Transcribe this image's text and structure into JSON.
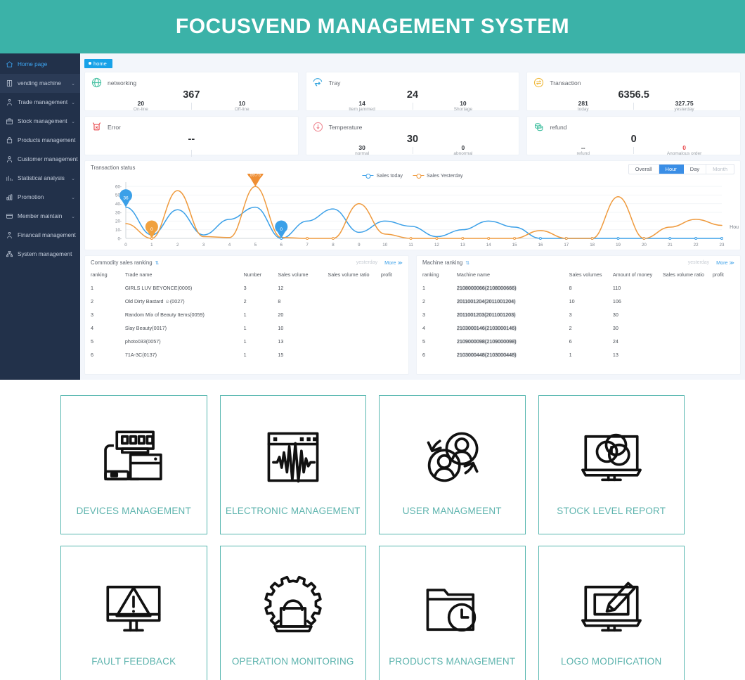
{
  "banner": {
    "title": "FOCUSVEND MANAGEMENT SYSTEM",
    "bg": "#3bb2a8"
  },
  "sidebar": {
    "items": [
      {
        "label": "Home page",
        "icon": "home-icon",
        "caret": "",
        "active": true,
        "highlight": false
      },
      {
        "label": "vending machine",
        "icon": "machine-icon",
        "caret": "⌄",
        "active": false,
        "highlight": true
      },
      {
        "label": "Trade management",
        "icon": "trade-icon",
        "caret": "⌄",
        "active": false,
        "highlight": false
      },
      {
        "label": "Stock management",
        "icon": "stock-icon",
        "caret": "⌄",
        "active": false,
        "highlight": false
      },
      {
        "label": "Products management",
        "icon": "products-icon",
        "caret": "",
        "active": false,
        "highlight": false
      },
      {
        "label": "Customer management",
        "icon": "customer-icon",
        "caret": "",
        "active": false,
        "highlight": false
      },
      {
        "label": "Statistical analysis",
        "icon": "statistics-icon",
        "caret": "⌄",
        "active": false,
        "highlight": false
      },
      {
        "label": "Promotion",
        "icon": "promotion-icon",
        "caret": "⌄",
        "active": false,
        "highlight": false
      },
      {
        "label": "Member maintain",
        "icon": "member-icon",
        "caret": "⌄",
        "active": false,
        "highlight": false
      },
      {
        "label": "Financail management",
        "icon": "finance-icon",
        "caret": "",
        "active": false,
        "highlight": false
      },
      {
        "label": "System management",
        "icon": "system-icon",
        "caret": "",
        "active": false,
        "highlight": false
      }
    ]
  },
  "tabbar": {
    "tab_label": "home"
  },
  "stats": [
    {
      "title": "networking",
      "icon": "globe-icon",
      "icon_color": "#4cc3a5",
      "main": "367",
      "left": {
        "value": "20",
        "label": "On-line",
        "red": false
      },
      "right": {
        "value": "10",
        "label": "Off-line",
        "red": false
      }
    },
    {
      "title": "Tray",
      "icon": "tray-icon",
      "icon_color": "#2fa3dd",
      "main": "24",
      "left": {
        "value": "14",
        "label": "Item jammed",
        "red": false
      },
      "right": {
        "value": "10",
        "label": "Shortage",
        "red": false
      }
    },
    {
      "title": "Transaction",
      "icon": "transaction-icon",
      "icon_color": "#f0b93c",
      "main": "6356.5",
      "left": {
        "value": "281",
        "label": "today",
        "red": false
      },
      "right": {
        "value": "327.75",
        "label": "yesterday",
        "red": false
      }
    },
    {
      "title": "Error",
      "icon": "error-icon",
      "icon_color": "#e8484c",
      "main": "--",
      "left": {
        "value": "",
        "label": "",
        "red": false
      },
      "right": {
        "value": "",
        "label": "",
        "red": false
      }
    },
    {
      "title": "Temperature",
      "icon": "temperature-icon",
      "icon_color": "#ef8a94",
      "main": "30",
      "left": {
        "value": "30",
        "label": "normal",
        "red": false
      },
      "right": {
        "value": "0",
        "label": "abnormal",
        "red": false
      }
    },
    {
      "title": "refund",
      "icon": "refund-icon",
      "icon_color": "#4cc3a5",
      "main": "0",
      "left": {
        "value": "--",
        "label": "refund",
        "red": false
      },
      "right": {
        "value": "0",
        "label": "Anomalous order",
        "red": true
      }
    }
  ],
  "chart_panel": {
    "title": "Transaction status",
    "range_tabs": [
      {
        "label": "Overall",
        "selected": false,
        "muted": false
      },
      {
        "label": "Hour",
        "selected": true,
        "muted": false
      },
      {
        "label": "Day",
        "selected": false,
        "muted": false
      },
      {
        "label": "Month",
        "selected": false,
        "muted": true
      }
    ],
    "axis_unit_label": "Hou"
  },
  "chart_data": {
    "type": "line",
    "title": "Transaction status",
    "xlabel": "Hou",
    "ylabel": "",
    "xlim": [
      0,
      23
    ],
    "ylim": [
      0,
      60
    ],
    "yticks": [
      0,
      10,
      20,
      30,
      40,
      50,
      60
    ],
    "x": [
      0,
      1,
      2,
      3,
      4,
      5,
      6,
      7,
      8,
      9,
      10,
      11,
      12,
      13,
      14,
      15,
      16,
      17,
      18,
      19,
      20,
      21,
      22,
      23
    ],
    "grid": true,
    "legend_position": "top-center",
    "series": [
      {
        "name": "Sales today",
        "color": "#3ba0e8",
        "values": [
          36,
          4,
          33,
          4,
          22,
          36,
          0,
          20,
          34,
          7,
          20,
          14,
          2,
          10,
          20,
          13,
          0,
          0,
          0,
          0,
          0,
          0,
          0,
          0
        ]
      },
      {
        "name": "Sales Yesterday",
        "color": "#ef9a3d",
        "values": [
          17,
          0,
          55,
          2,
          1,
          59.75,
          1,
          0,
          0,
          40,
          5,
          0,
          0,
          0,
          0,
          0,
          9,
          0,
          0,
          48,
          0,
          13,
          22,
          15
        ]
      }
    ],
    "annotations": [
      {
        "x": 0,
        "y": 36,
        "text": "36",
        "series": "Sales today",
        "color": "#3ba0e8"
      },
      {
        "x": 1,
        "y": 0,
        "text": "0",
        "series": "Sales Yesterday",
        "color": "#f0a13f"
      },
      {
        "x": 5,
        "y": 59.75,
        "text": "59.75",
        "series": "Sales Yesterday",
        "color": "#ef8f34"
      },
      {
        "x": 6,
        "y": 0,
        "text": "0",
        "series": "Sales today",
        "color": "#3ba0e8"
      }
    ]
  },
  "commodity_panel": {
    "title": "Commodity sales ranking",
    "sort_icon": "sort-icon",
    "period": "yesterday",
    "more_label": "More ≫",
    "columns": [
      "ranking",
      "Trade name",
      "Number",
      "Sales volume",
      "Sales volume ratio",
      "profit"
    ],
    "rows": [
      {
        "ranking": "1",
        "name": "GIRLS LUV BEYONCE(0006)",
        "number": "3",
        "volume": "12",
        "ratio": "",
        "profit": ""
      },
      {
        "ranking": "2",
        "name": "Old Dirty Bastard ☺(0027)",
        "number": "2",
        "volume": "8",
        "ratio": "",
        "profit": ""
      },
      {
        "ranking": "3",
        "name": "Random Mix of Beauty Items(0059)",
        "number": "1",
        "volume": "20",
        "ratio": "",
        "profit": ""
      },
      {
        "ranking": "4",
        "name": "Slay Beauty(0017)",
        "number": "1",
        "volume": "10",
        "ratio": "",
        "profit": ""
      },
      {
        "ranking": "5",
        "name": "photo033(0057)",
        "number": "1",
        "volume": "13",
        "ratio": "",
        "profit": ""
      },
      {
        "ranking": "6",
        "name": "71A-3C(0137)",
        "number": "1",
        "volume": "15",
        "ratio": "",
        "profit": ""
      }
    ]
  },
  "machine_panel": {
    "title": "Machine ranking",
    "sort_icon": "sort-icon",
    "period": "yesterday",
    "more_label": "More ≫",
    "columns": [
      "ranking",
      "Machine name",
      "Sales volumes",
      "Amount of money",
      "Sales volume ratio",
      "profit"
    ],
    "rows": [
      {
        "ranking": "1",
        "name": "2108000066(2108000666)",
        "volumes": "8",
        "amount": "110",
        "ratio": "",
        "profit": ""
      },
      {
        "ranking": "2",
        "name": "2011001204(2011001204)",
        "volumes": "10",
        "amount": "106",
        "ratio": "",
        "profit": ""
      },
      {
        "ranking": "3",
        "name": "2011001203(2011001203)",
        "volumes": "3",
        "amount": "30",
        "ratio": "",
        "profit": ""
      },
      {
        "ranking": "4",
        "name": "2103000146(2103000146)",
        "volumes": "2",
        "amount": "30",
        "ratio": "",
        "profit": ""
      },
      {
        "ranking": "5",
        "name": "2109000098(2109000098)",
        "volumes": "6",
        "amount": "24",
        "ratio": "",
        "profit": ""
      },
      {
        "ranking": "6",
        "name": "2103000448(2103000448)",
        "volumes": "1",
        "amount": "13",
        "ratio": "",
        "profit": ""
      }
    ]
  },
  "tiles": {
    "accent": "#56b6af",
    "items": [
      {
        "label": "DEVICES MANAGEMENT",
        "icon": "devices-icon"
      },
      {
        "label": "ELECTRONIC MANAGEMENT",
        "icon": "waveform-icon"
      },
      {
        "label": "USER MANAGMEENT",
        "icon": "users-icon"
      },
      {
        "label": "STOCK LEVEL REPORT",
        "icon": "monitor-chart-icon"
      },
      {
        "label": "FAULT FEEDBACK",
        "icon": "monitor-warning-icon"
      },
      {
        "label": "OPERATION MONITORING",
        "icon": "gear-laptop-icon"
      },
      {
        "label": "PRODUCTS MANAGEMENT",
        "icon": "folder-clock-icon"
      },
      {
        "label": "LOGO MODIFICATION",
        "icon": "monitor-brush-icon"
      }
    ]
  }
}
